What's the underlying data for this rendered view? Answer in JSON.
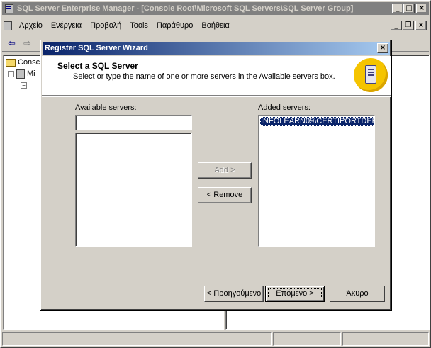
{
  "main_window": {
    "title": "SQL Server Enterprise Manager - [Console Root\\Microsoft SQL Servers\\SQL Server Group]",
    "menu": [
      "Αρχείο",
      "Ενέργεια",
      "Προβολή",
      "Tools",
      "Παράθυρο",
      "Βοήθεια"
    ],
    "tree": {
      "root": "Consc",
      "child": "Mi"
    }
  },
  "wizard": {
    "title": "Register SQL Server Wizard",
    "header_title": "Select a SQL Server",
    "header_subtitle": "Select or type the name of one or more servers in the Available servers box.",
    "available_label": "Available servers:",
    "available_input_value": "",
    "added_label": "Added servers:",
    "added_servers": [
      "INFOLEARN09\\CERTIPORTDEF"
    ],
    "add_button": "Add >",
    "remove_button": "< Remove",
    "back_button": "< Προηγούμενο",
    "next_button": "Επόμενο >",
    "cancel_button": "Άκυρο",
    "close_glyph": "×"
  },
  "icons": {
    "minimize": "minimize-icon",
    "maximize": "maximize-icon",
    "close": "close-icon",
    "back": "back-arrow-icon",
    "forward": "forward-arrow-icon"
  }
}
